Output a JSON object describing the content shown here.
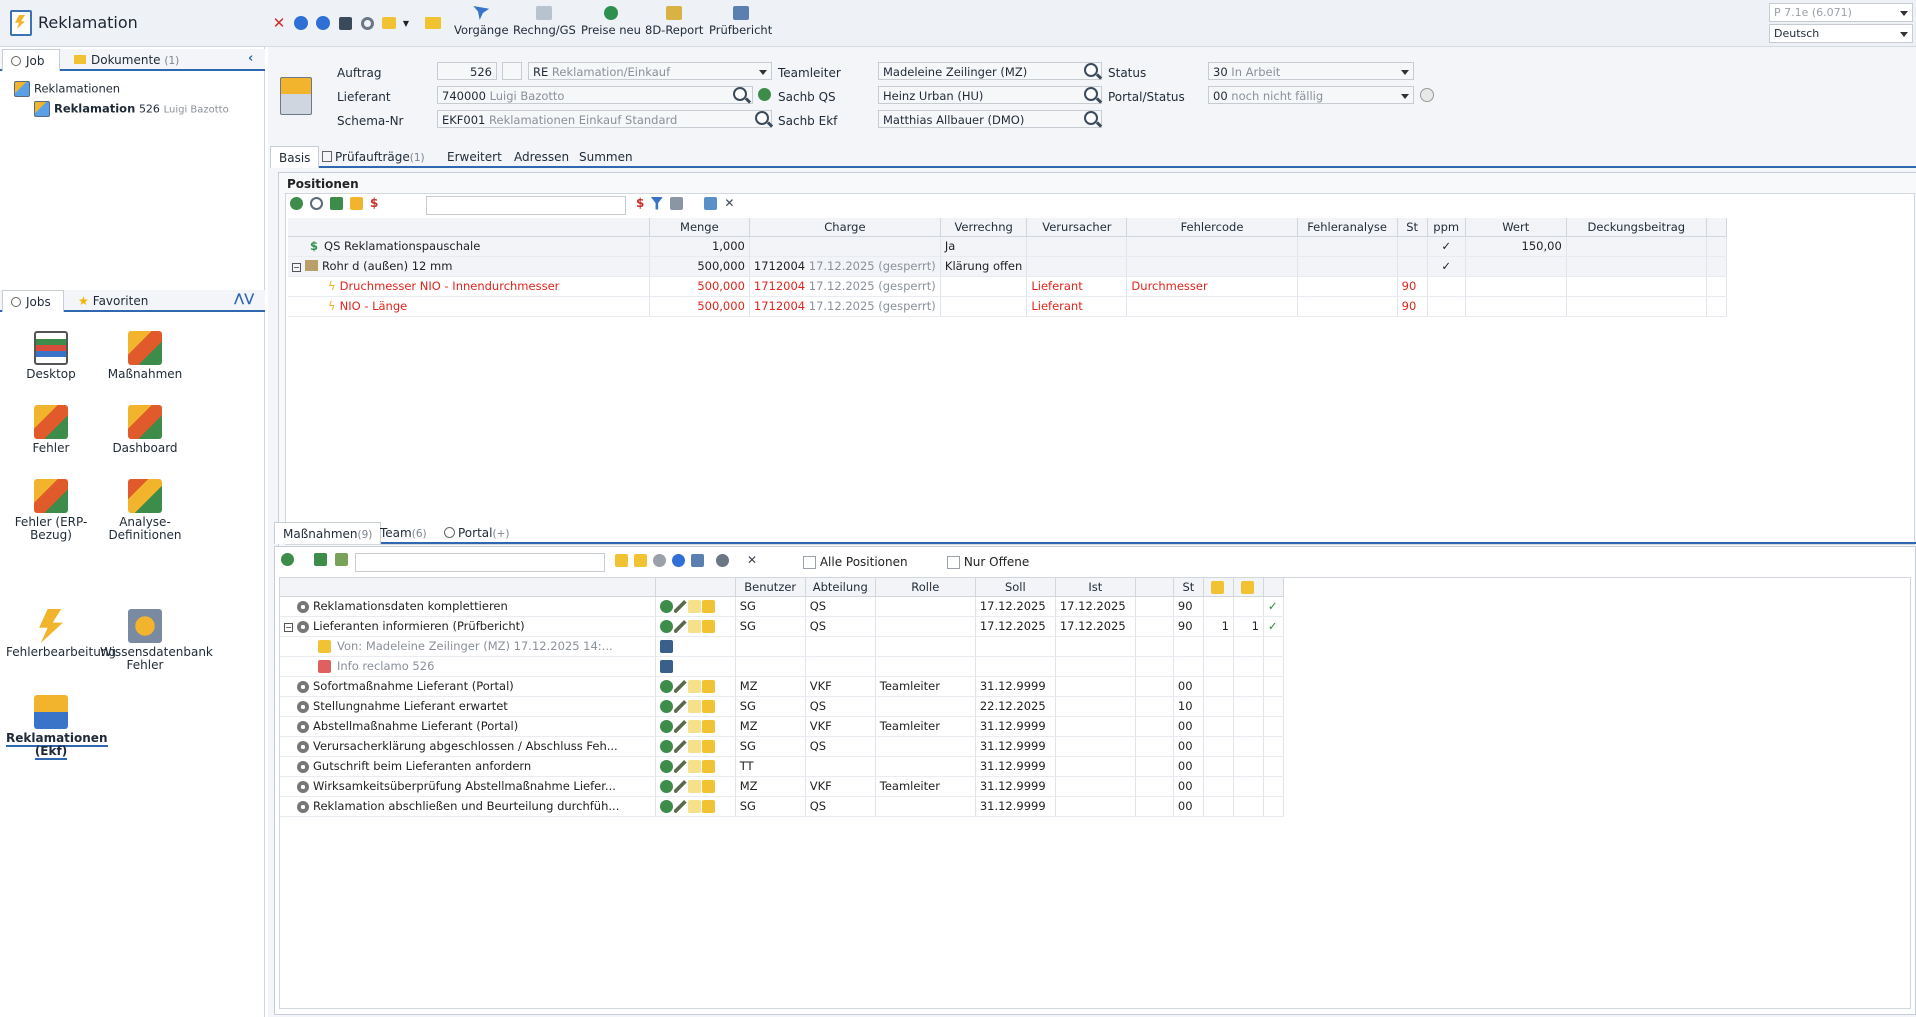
{
  "app": {
    "title": "Reklamation",
    "version": "P 7.1e (6.071)",
    "language": "Deutsch"
  },
  "toolbar": {
    "buttons": [
      {
        "label": "Vorgänge"
      },
      {
        "label": "Rechng/GS"
      },
      {
        "label": "Preise neu"
      },
      {
        "label": "8D-Report"
      },
      {
        "label": "Prüfbericht"
      }
    ]
  },
  "left": {
    "tabs": [
      {
        "label": "Job"
      },
      {
        "label": "Dokumente",
        "count": "(1)"
      }
    ],
    "tree": {
      "root": "Reklamationen",
      "child": "Reklamation",
      "child_no": "526",
      "child_sub": "Luigi Bazotto"
    },
    "jobs_tabs": [
      {
        "label": "Jobs"
      },
      {
        "label": "Favoriten"
      }
    ],
    "tiles": [
      {
        "label": "Desktop"
      },
      {
        "label": "Maßnahmen"
      },
      {
        "label": "Fehler"
      },
      {
        "label": "Dashboard"
      },
      {
        "label": "Fehler (ERP-Bezug)"
      },
      {
        "label": "Analyse-Definitionen"
      },
      {
        "label": "Fehlerbearbeitung"
      },
      {
        "label": "Wissensdatenbank Fehler"
      },
      {
        "label": "Reklamationen (Ekf)"
      }
    ]
  },
  "header": {
    "auftrag_label": "Auftrag",
    "auftrag_no": "526",
    "auftrag_type": "RE",
    "auftrag_type_desc": "Reklamation/Einkauf",
    "lieferant_label": "Lieferant",
    "lieferant_no": "740000",
    "lieferant_name": "Luigi Bazotto",
    "schema_label": "Schema-Nr",
    "schema_no": "EKF001",
    "schema_name": "Reklamationen Einkauf Standard",
    "teamleiter_label": "Teamleiter",
    "teamleiter": "Madeleine Zeilinger (MZ)",
    "sachbqs_label": "Sachb QS",
    "sachbqs": "Heinz Urban (HU)",
    "sachbekf_label": "Sachb Ekf",
    "sachbekf": "Matthias Allbauer (DMO)",
    "status_label": "Status",
    "status_no": "30",
    "status_text": "In Arbeit",
    "portal_label": "Portal/Status",
    "portal_no": "00",
    "portal_text": "noch nicht fällig"
  },
  "main_tabs": [
    {
      "label": "Basis"
    },
    {
      "label": "Prüfaufträge",
      "count": "(1)"
    },
    {
      "label": "Erweitert"
    },
    {
      "label": "Adressen"
    },
    {
      "label": "Summen"
    }
  ],
  "positionen": {
    "title": "Positionen",
    "columns": [
      "Menge",
      "Charge",
      "Verrechng",
      "Verursacher",
      "Fehlercode",
      "Fehleranalyse",
      "St",
      "ppm",
      "Wert",
      "Deckungsbeitrag"
    ],
    "rows": [
      {
        "name": "QS Reklamationspauschale",
        "menge": "1,000",
        "charge": "",
        "charge_sub": "",
        "verrechng": "Ja",
        "verursacher": "",
        "fehlercode": "",
        "st": "",
        "ppm": "✓",
        "wert": "150,00"
      },
      {
        "name": "Rohr d (außen) 12 mm",
        "menge": "500,000",
        "charge": "1712004",
        "charge_sub": "17.12.2025 (gesperrt)",
        "verrechng": "Klärung offen",
        "verursacher": "",
        "fehlercode": "",
        "st": "",
        "ppm": "✓",
        "wert": ""
      },
      {
        "name": "Druchmesser NIO  - Innendurchmesser",
        "menge": "500,000",
        "charge": "1712004",
        "charge_sub": "17.12.2025 (gesperrt)",
        "verrechng": "",
        "verursacher": "Lieferant",
        "fehlercode": "Durchmesser",
        "st": "90",
        "ppm": "",
        "wert": ""
      },
      {
        "name": "NIO - Länge",
        "menge": "500,000",
        "charge": "1712004",
        "charge_sub": "17.12.2025 (gesperrt)",
        "verrechng": "",
        "verursacher": "Lieferant",
        "fehlercode": "",
        "st": "90",
        "ppm": "",
        "wert": ""
      }
    ]
  },
  "lower_tabs": [
    {
      "label": "Maßnahmen",
      "count": "(9)"
    },
    {
      "label": "Team",
      "count": "(6)"
    },
    {
      "label": "Portal",
      "count": "(+)"
    }
  ],
  "massnahmen": {
    "filter_all": "Alle Positionen",
    "filter_open": "Nur Offene",
    "columns": [
      "Benutzer",
      "Abteilung",
      "Rolle",
      "Soll",
      "Ist",
      "St"
    ],
    "rows": [
      {
        "name": "Reklamationsdaten komplettieren",
        "benutzer": "SG",
        "abteilung": "QS",
        "rolle": "",
        "soll": "17.12.2025",
        "ist": "17.12.2025",
        "st": "90",
        "c1": "",
        "c2": "",
        "done": "✓"
      },
      {
        "name": "Lieferanten informieren (Prüfbericht)",
        "benutzer": "SG",
        "abteilung": "QS",
        "rolle": "",
        "soll": "17.12.2025",
        "ist": "17.12.2025",
        "st": "90",
        "c1": "1",
        "c2": "1",
        "done": "✓"
      },
      {
        "name": "Von: Madeleine Zeilinger (MZ) 17.12.2025 14:...",
        "sub": true
      },
      {
        "name": "Info reclamo 526",
        "sub": true
      },
      {
        "name": "Sofortmaßnahme Lieferant (Portal)",
        "benutzer": "MZ",
        "abteilung": "VKF",
        "rolle": "Teamleiter",
        "soll": "31.12.9999",
        "ist": "",
        "st": "00"
      },
      {
        "name": "Stellungnahme Lieferant erwartet",
        "benutzer": "SG",
        "abteilung": "QS",
        "rolle": "",
        "soll": "22.12.2025",
        "ist": "",
        "st": "10"
      },
      {
        "name": "Abstellmaßnahme Lieferant (Portal)",
        "benutzer": "MZ",
        "abteilung": "VKF",
        "rolle": "Teamleiter",
        "soll": "31.12.9999",
        "ist": "",
        "st": "00"
      },
      {
        "name": "Verursacherklärung abgeschlossen / Abschluss Feh...",
        "benutzer": "SG",
        "abteilung": "QS",
        "rolle": "",
        "soll": "31.12.9999",
        "ist": "",
        "st": "00"
      },
      {
        "name": "Gutschrift beim Lieferanten anfordern",
        "benutzer": "TT",
        "abteilung": "",
        "rolle": "",
        "soll": "31.12.9999",
        "ist": "",
        "st": "00"
      },
      {
        "name": "Wirksamkeitsüberprüfung Abstellmaßnahme Liefer...",
        "benutzer": "MZ",
        "abteilung": "VKF",
        "rolle": "Teamleiter",
        "soll": "31.12.9999",
        "ist": "",
        "st": "00"
      },
      {
        "name": "Reklamation abschließen und Beurteilung durchfüh...",
        "benutzer": "SG",
        "abteilung": "QS",
        "rolle": "",
        "soll": "31.12.9999",
        "ist": "",
        "st": "00"
      }
    ]
  }
}
